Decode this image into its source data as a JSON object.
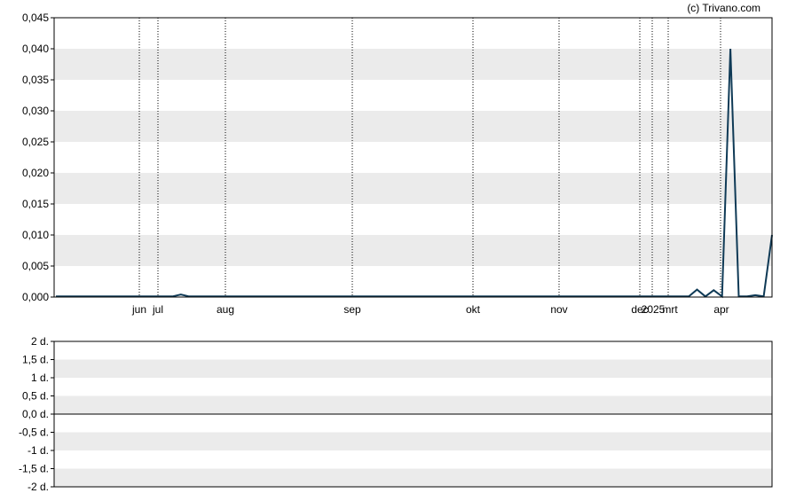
{
  "copyright": "(c) Trivano.com",
  "colors": {
    "line": "#0f3a56",
    "band": "#ebebeb",
    "frame": "#000000",
    "grid": "#000000"
  },
  "chart_data": [
    {
      "type": "line",
      "x_tick_labels": [
        "jun",
        "jul",
        "aug",
        "sep",
        "okt",
        "nov",
        "dec",
        "2025",
        "mrt",
        "apr"
      ],
      "y_tick_labels": [
        "0,045",
        "0,040",
        "0,035",
        "0,030",
        "0,025",
        "0,020",
        "0,015",
        "0,010",
        "0,005",
        "0,000"
      ],
      "ylim": [
        0,
        0.045
      ],
      "grid": "alternating horizontal bands, dotted vertical lines at month ticks",
      "series": [
        {
          "x_index": [
            0,
            14,
            15,
            16,
            28,
            29,
            30,
            32,
            40,
            42,
            44,
            45,
            50,
            55,
            60,
            64,
            68,
            70,
            71,
            72,
            73,
            74,
            75,
            76,
            77,
            78,
            79,
            80,
            81,
            82,
            83,
            84,
            85,
            86
          ],
          "values": [
            0.0001,
            0.0001,
            0.0004,
            0.0001,
            0.0001,
            0.0001,
            0.0001,
            0.0001,
            0.0001,
            0.0001,
            0.0001,
            0.0001,
            0.0001,
            0.0001,
            0.0001,
            0.0001,
            0.0001,
            0.0001,
            0.0001,
            0.0001,
            0.0001,
            0.0001,
            0.0001,
            0.0001,
            0.0012,
            0.0001,
            0.0011,
            0.0001,
            0.04,
            0.0001,
            0.0001,
            0.0003,
            0.0001,
            0.01
          ]
        }
      ]
    },
    {
      "type": "bar",
      "y_tick_labels": [
        "2 d.",
        "1,5 d.",
        "1 d.",
        "0,5 d.",
        "0,0 d.",
        "-0,5 d.",
        "-1 d.",
        "-1,5 d.",
        "-2 d."
      ],
      "ylim": [
        -2,
        2
      ],
      "values": []
    }
  ]
}
